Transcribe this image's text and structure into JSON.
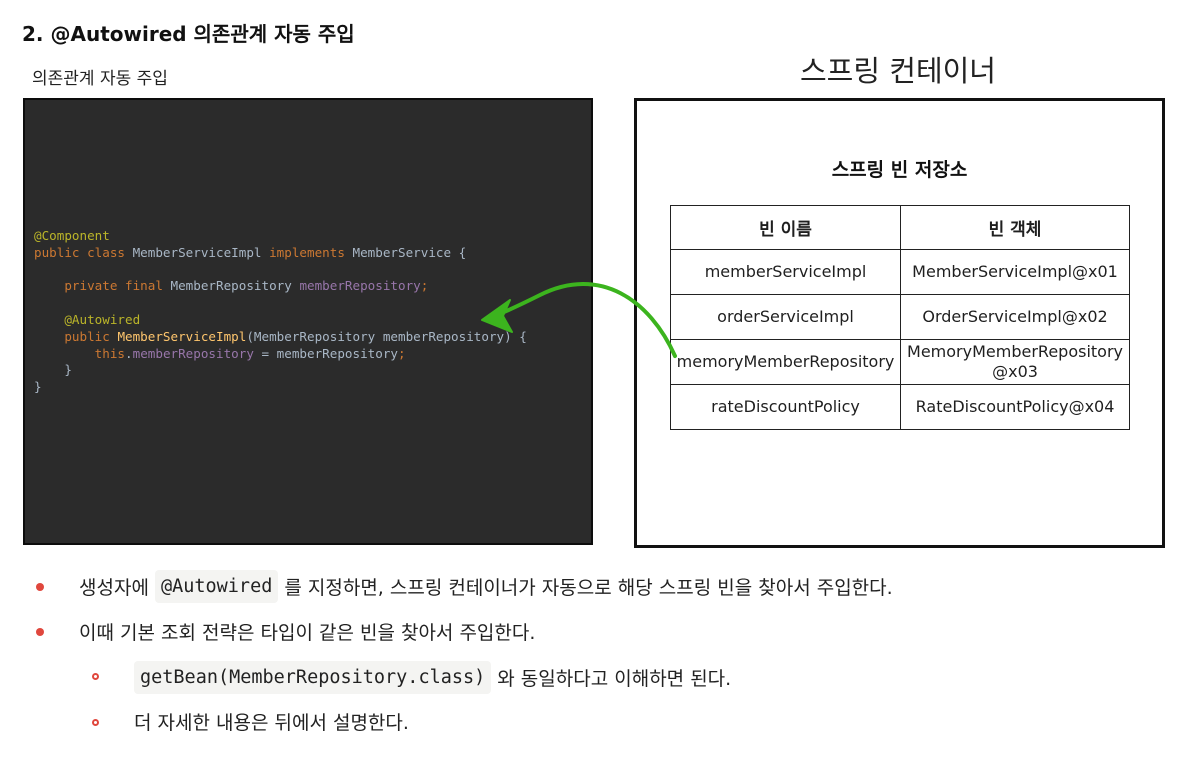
{
  "heading": "2. @Autowired 의존관계 자동 주입",
  "subtitle": "의존관계 자동 주입",
  "container_title": "스프링 컨테이너",
  "code": {
    "line1_annotation": "@Component",
    "line2_kw1": "public class",
    "line2_class": "MemberServiceImpl",
    "line2_kw2": "implements",
    "line2_iface": "MemberService {",
    "line3_kw": "private final",
    "line3_type": "MemberRepository",
    "line3_field": "memberRepository",
    "line3_end": ";",
    "line4_annotation": "@Autowired",
    "line5_kw": "public",
    "line5_ctor": "MemberServiceImpl",
    "line5_params": "(MemberRepository memberRepository) {",
    "line6_this": "this",
    "line6_dot": ".",
    "line6_field": "memberRepository",
    "line6_assign": " = memberRepository",
    "line6_end": ";",
    "line7_close": "}",
    "line8_close": "}"
  },
  "bean_store": {
    "title": "스프링 빈 저장소",
    "headers": [
      "빈 이름",
      "빈 객체"
    ],
    "rows": [
      {
        "name": "memberServiceImpl",
        "object": "MemberServiceImpl@x01"
      },
      {
        "name": "orderServiceImpl",
        "object": "OrderServiceImpl@x02"
      },
      {
        "name": "memoryMemberRepository",
        "object": "MemoryMemberRepository @x03"
      },
      {
        "name": "rateDiscountPolicy",
        "object": "RateDiscountPolicy@x04"
      }
    ]
  },
  "colors": {
    "arrow": "#3cb41e",
    "bullet": "#e0473d",
    "code_bg": "#2b2b2b"
  },
  "bullets": [
    {
      "code": "@Autowired",
      "text": "를 지정하면, 스프링 컨테이너가 자동으로 해당 스프링 빈을 찾아서 주입한다.",
      "prefix": "생성자에"
    },
    {
      "text": "이때 기본 조회 전략은 타입이 같은 빈을 찾아서 주입한다."
    }
  ],
  "sub_bullets": [
    {
      "code": "getBean(MemberRepository.class)",
      "text": "와 동일하다고 이해하면 된다."
    },
    {
      "text": "더 자세한 내용은 뒤에서 설명한다."
    }
  ]
}
